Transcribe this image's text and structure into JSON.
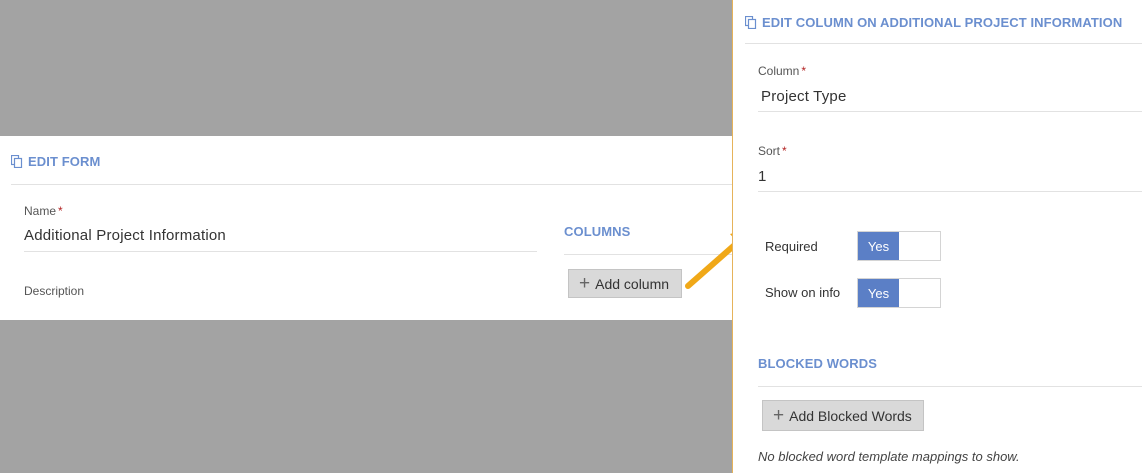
{
  "edit_form": {
    "title": "EDIT FORM",
    "name_label": "Name",
    "name_value": "Additional Project Information",
    "description_label": "Description",
    "columns_title": "COLUMNS",
    "add_column_label": "Add column"
  },
  "edit_column": {
    "title": "EDIT COLUMN ON ADDITIONAL PROJECT INFORMATION",
    "column_label": "Column",
    "column_value": "Project Type",
    "sort_label": "Sort",
    "sort_value": "1",
    "required_label": "Required",
    "required_toggle": "Yes",
    "show_on_info_label": "Show on info",
    "show_on_info_toggle": "Yes",
    "blocked_words_title": "BLOCKED WORDS",
    "add_blocked_words_label": "Add Blocked Words",
    "empty_message": "No blocked word template mappings to show."
  },
  "required_marker": "*",
  "colors": {
    "accent": "#6b8fcf",
    "toggle_on": "#5b7fc6",
    "arrow": "#f0a818",
    "required": "#b22222"
  },
  "icons": [
    "copy-icon",
    "plus-icon",
    "arrow-pointer"
  ]
}
